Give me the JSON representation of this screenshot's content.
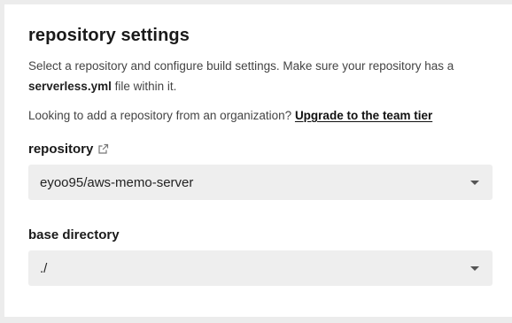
{
  "card": {
    "title": "repository settings",
    "description_prefix": "Select a repository and configure build settings. Make sure your repository has a ",
    "description_filename": "serverless.yml",
    "description_suffix": " file within it.",
    "org_note_text": "Looking to add a repository from an organization? ",
    "org_note_link": "Upgrade to the team tier"
  },
  "repository": {
    "label": "repository",
    "icon": "external-link-icon",
    "selected": "eyoo95/aws-memo-server"
  },
  "base_directory": {
    "label": "base directory",
    "selected": "./"
  }
}
